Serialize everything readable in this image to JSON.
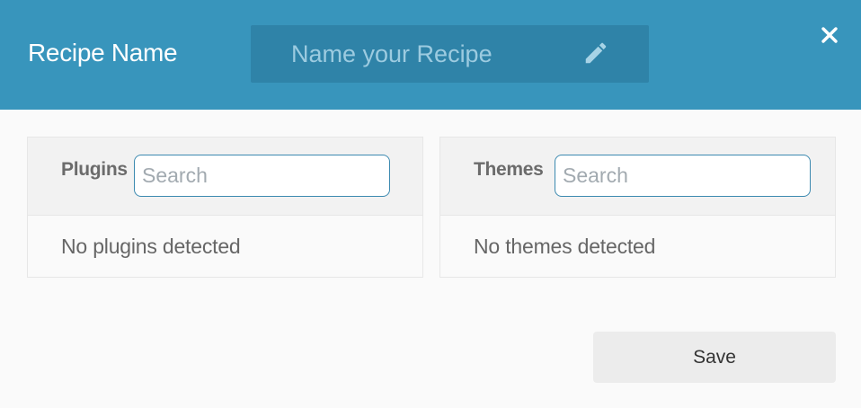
{
  "header": {
    "title": "Recipe Name",
    "name_input": {
      "value": "",
      "placeholder": "Name your Recipe"
    },
    "edit_icon": "pencil-icon",
    "close_icon": "close-icon"
  },
  "panels": {
    "plugins": {
      "title": "Plugins",
      "search_placeholder": "Search",
      "empty_text": "No plugins detected"
    },
    "themes": {
      "title": "Themes",
      "search_placeholder": "Search",
      "empty_text": "No themes detected"
    }
  },
  "footer": {
    "save_label": "Save"
  },
  "colors": {
    "header_bg": "#3895bc",
    "name_field_bg": "#2f83a8",
    "page_bg": "#fafafa",
    "panel_head_bg": "#f2f2f2",
    "search_border": "#3c8ab0",
    "save_bg": "#ececec"
  }
}
